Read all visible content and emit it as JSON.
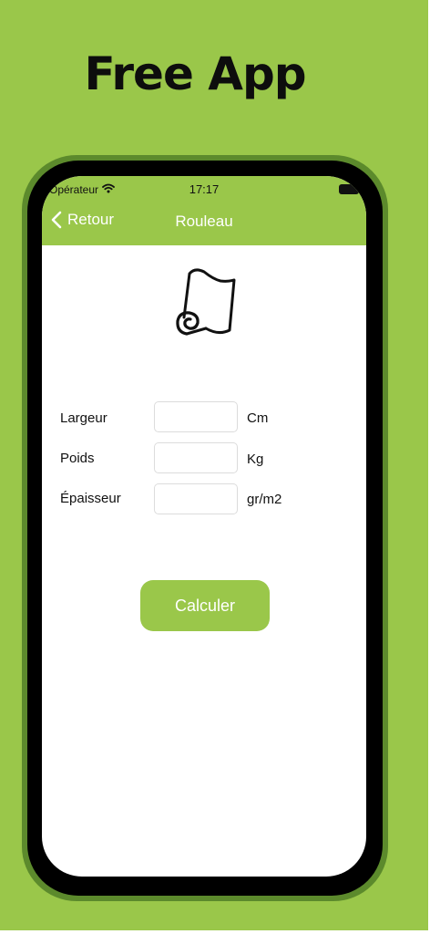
{
  "headline": "Free App",
  "status_bar": {
    "carrier": "Opérateur",
    "time": "17:17"
  },
  "nav": {
    "back_label": "Retour",
    "title": "Rouleau"
  },
  "form": {
    "rows": [
      {
        "label": "Largeur",
        "value": "",
        "unit": "Cm"
      },
      {
        "label": "Poids",
        "value": "",
        "unit": "Kg"
      },
      {
        "label": "Épaisseur",
        "value": "",
        "unit": "gr/m2"
      }
    ]
  },
  "calculate_button": "Calculer",
  "icons": {
    "back": "chevron-left-icon",
    "wifi": "wifi-icon",
    "battery": "battery-icon",
    "product": "paper-roll-icon"
  },
  "colors": {
    "brand_green": "#9ac74a",
    "frame_green": "#5c8a2c"
  }
}
